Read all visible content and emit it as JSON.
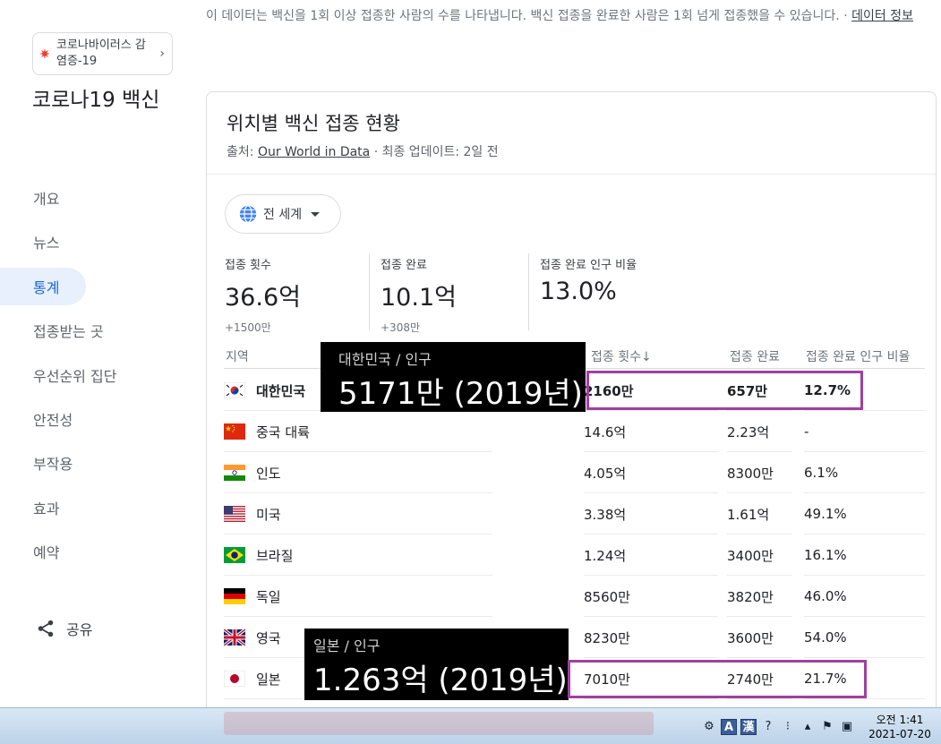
{
  "notice": {
    "text": "이 데이터는 백신을 1회 이상 접종한 사람의 수를 나타냅니다. 백신 접종을 완료한 사람은 1회 넘게 접종했을 수 있습니다.",
    "separator": "·",
    "link": "데이터 정보"
  },
  "sidebar": {
    "topic_chip": "코로나바이러스 감염증-19",
    "chip_arrow": "›",
    "title": "코로나19 백신",
    "items": [
      {
        "label": "개요"
      },
      {
        "label": "뉴스"
      },
      {
        "label": "통계"
      },
      {
        "label": "접종받는 곳"
      },
      {
        "label": "우선순위 집단"
      },
      {
        "label": "안전성"
      },
      {
        "label": "부작용"
      },
      {
        "label": "효과"
      },
      {
        "label": "예약"
      }
    ],
    "active_index": 2,
    "share": "공유"
  },
  "card": {
    "title": "위치별 백신 접종 현황",
    "source_prefix": "출처: ",
    "source_link": "Our World in Data",
    "source_suffix": " · 최종 업데이트: 2일 전",
    "region_select": "전 세계",
    "stats": [
      {
        "label": "접종 횟수",
        "value": "36.6억",
        "delta": "+1500만"
      },
      {
        "label": "접종 완료",
        "value": "10.1억",
        "delta": "+308만"
      },
      {
        "label": "접종 완료 인구 비율",
        "value": "13.0%",
        "delta": ""
      }
    ]
  },
  "table": {
    "headers": {
      "region": "지역",
      "doses": "접종 횟수",
      "sort_arrow": "↓",
      "full": "접종 완료",
      "pct": "접종 완료 인구 비율"
    },
    "rows": [
      {
        "flag": "kr",
        "name": "대한민국",
        "doses": "2160만",
        "full": "657만",
        "pct": "12.7%"
      },
      {
        "flag": "cn",
        "name": "중국 대륙",
        "doses": "14.6억",
        "full": "2.23억",
        "pct": "-"
      },
      {
        "flag": "in",
        "name": "인도",
        "doses": "4.05억",
        "full": "8300만",
        "pct": "6.1%"
      },
      {
        "flag": "us",
        "name": "미국",
        "doses": "3.38억",
        "full": "1.61억",
        "pct": "49.1%"
      },
      {
        "flag": "br",
        "name": "브라질",
        "doses": "1.24억",
        "full": "3400만",
        "pct": "16.1%"
      },
      {
        "flag": "de",
        "name": "독일",
        "doses": "8560만",
        "full": "3820만",
        "pct": "46.0%"
      },
      {
        "flag": "gb",
        "name": "영국",
        "doses": "8230만",
        "full": "3600만",
        "pct": "54.0%"
      },
      {
        "flag": "jp",
        "name": "일본",
        "doses": "7010만",
        "full": "2740만",
        "pct": "21.7%"
      }
    ]
  },
  "overlays": {
    "korea": {
      "label": "대한민국 / 인구",
      "value": "5171만 (2019년)"
    },
    "japan": {
      "label": "일본 / 인구",
      "value": "1.263억 (2019년)"
    }
  },
  "taskbar": {
    "time": "오전 1:41",
    "date": "2021-07-20",
    "ime_a": "A",
    "ime_han": "漢"
  },
  "colors": {
    "accent": "#1967d2",
    "highlight": "#a040a0",
    "active_bg": "#e8f0fe"
  }
}
